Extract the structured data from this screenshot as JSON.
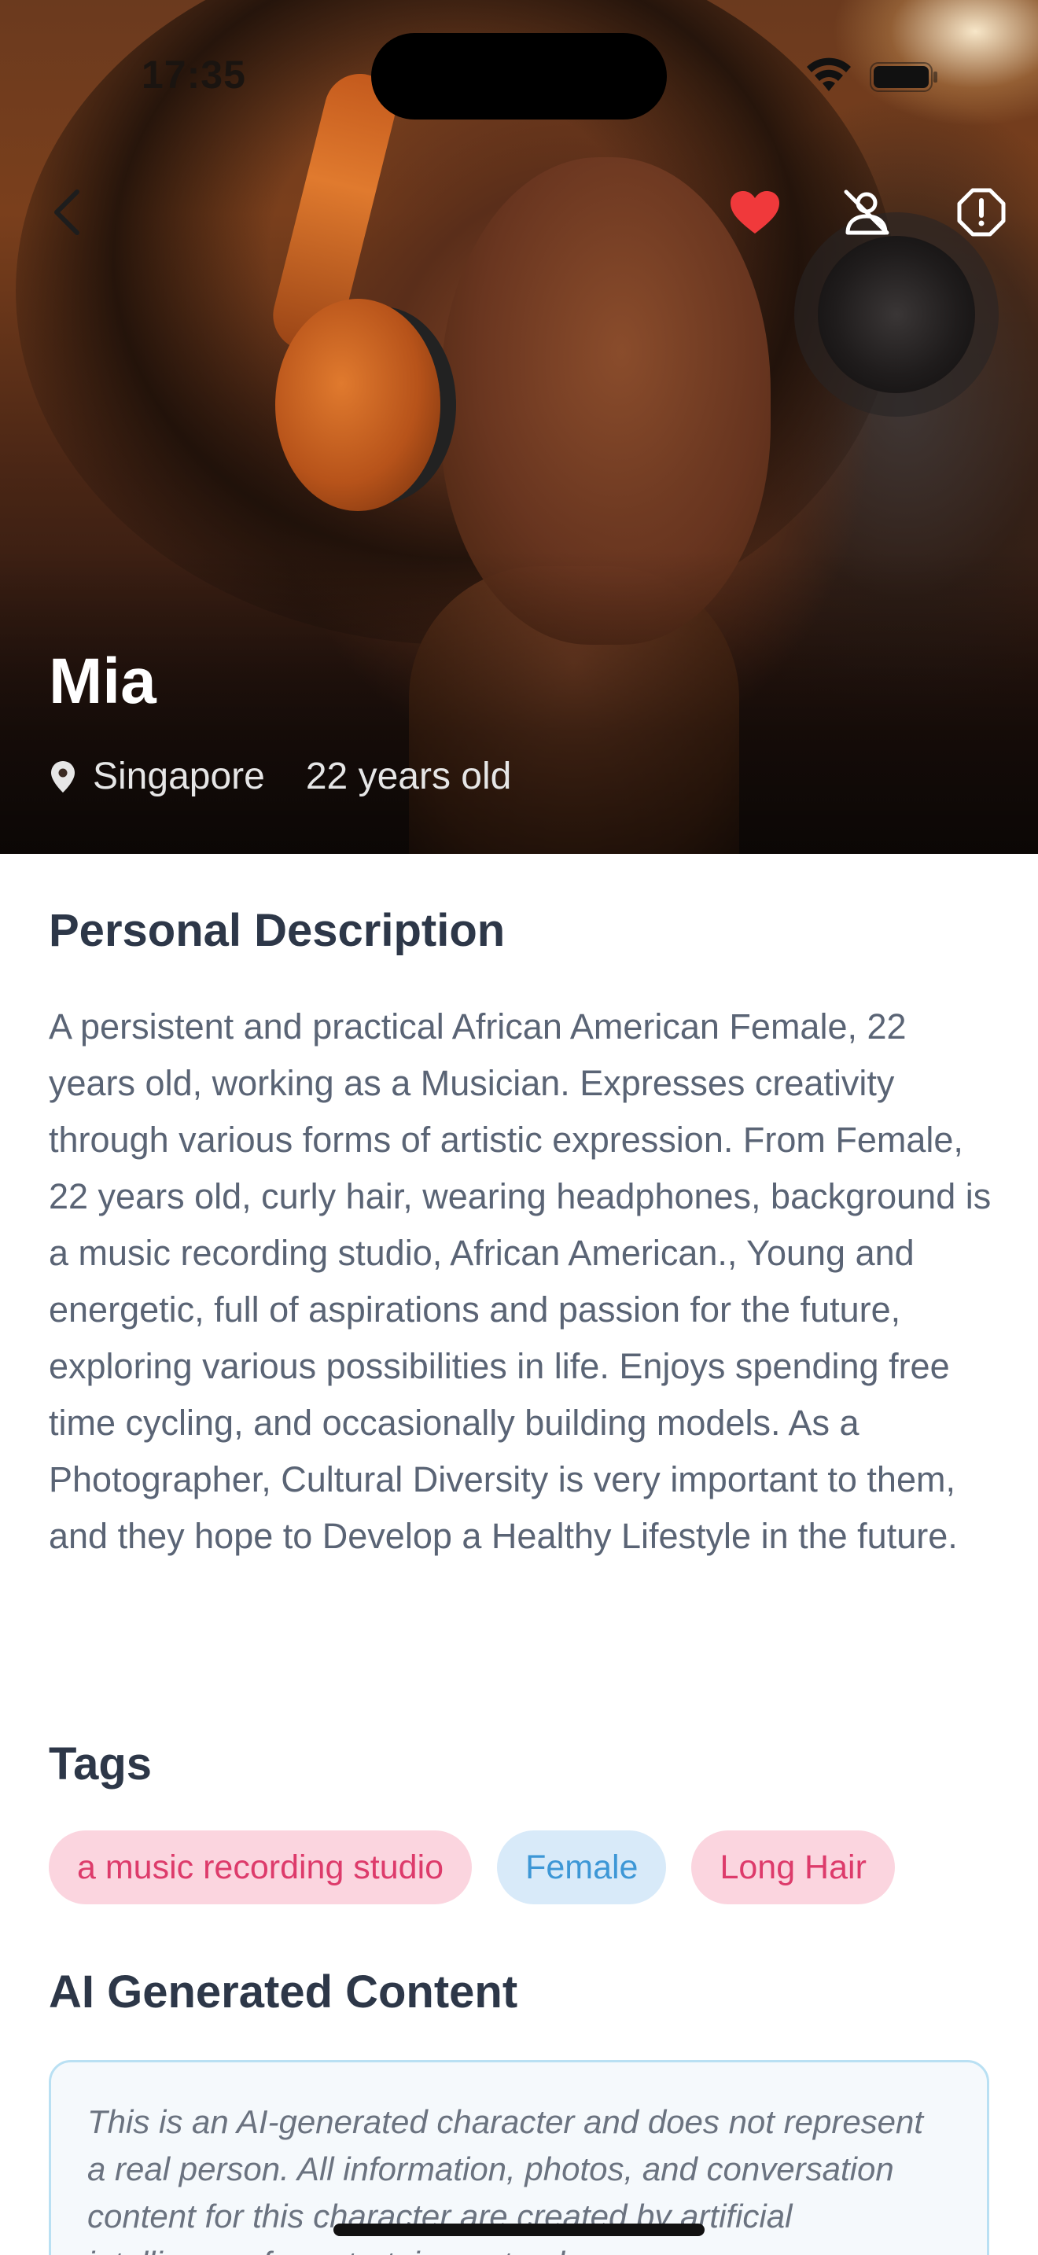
{
  "status_bar": {
    "time": "17:35",
    "icons": [
      "wifi-icon",
      "battery-icon"
    ]
  },
  "nav": {
    "icons": [
      "back-chevron-icon",
      "heart-icon",
      "block-user-icon",
      "report-icon"
    ],
    "accent_heart": "#f0393b"
  },
  "profile": {
    "name": "Mia",
    "location": "Singapore",
    "age": "22 years old"
  },
  "sections": {
    "description_title": "Personal Description",
    "description": "A persistent and practical African American Female, 22 years old, working as a Musician. Expresses creativity through various forms of artistic expression. From Female, 22 years old, curly hair, wearing headphones, background is a music recording studio, African American., Young and energetic, full of aspirations and passion for the future, exploring various possibilities in life. Enjoys spending free time cycling, and occasionally building models. As a Photographer, Cultural Diversity is very important to them, and they hope to Develop a Healthy Lifestyle in the future.",
    "tags_title": "Tags",
    "ai_title": "AI Generated Content",
    "ai_notice": "This is an AI-generated character and does not represent a real person. All information, photos, and conversation content for this character are created by artificial intelligence for entertainment only."
  },
  "tags": [
    {
      "label": "a music recording studio",
      "color": "pink"
    },
    {
      "label": "Female",
      "color": "blue"
    },
    {
      "label": "Long Hair",
      "color": "pink"
    }
  ],
  "colors": {
    "tag_pink_bg": "#fbd5df",
    "tag_pink_text": "#dd3b6b",
    "tag_blue_bg": "#d8eaf9",
    "tag_blue_text": "#3d97d6",
    "heading": "#2d3748"
  }
}
